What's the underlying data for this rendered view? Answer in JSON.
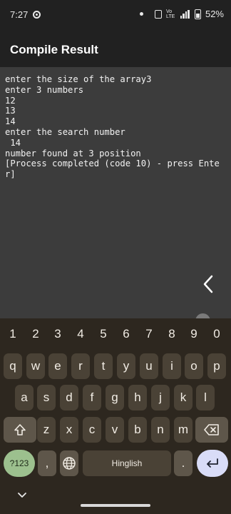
{
  "status_bar": {
    "time": "7:27",
    "volte": "Vo LTE",
    "battery_pct": "52%",
    "battery_level": 0.52
  },
  "app_bar": {
    "title": "Compile Result"
  },
  "console": {
    "output": "enter the size of the array3\nenter 3 numbers\n12\n13\n14\nenter the search number\n 14\nnumber found at 3 position\n[Process completed (code 10) - press Enter]"
  },
  "keyboard": {
    "number_row": [
      "1",
      "2",
      "3",
      "4",
      "5",
      "6",
      "7",
      "8",
      "9",
      "0"
    ],
    "row1": [
      "q",
      "w",
      "e",
      "r",
      "t",
      "y",
      "u",
      "i",
      "o",
      "p"
    ],
    "row2": [
      "a",
      "s",
      "d",
      "f",
      "g",
      "h",
      "j",
      "k",
      "l"
    ],
    "row3": [
      "z",
      "x",
      "c",
      "v",
      "b",
      "n",
      "m"
    ],
    "symbols_label": "?123",
    "comma_label": ",",
    "space_label": "Hinglish",
    "period_label": ".",
    "icons": {
      "shift": "shift-icon",
      "backspace": "backspace-icon",
      "globe": "globe-icon",
      "enter": "enter-icon",
      "hide": "chevron-down-icon"
    }
  }
}
